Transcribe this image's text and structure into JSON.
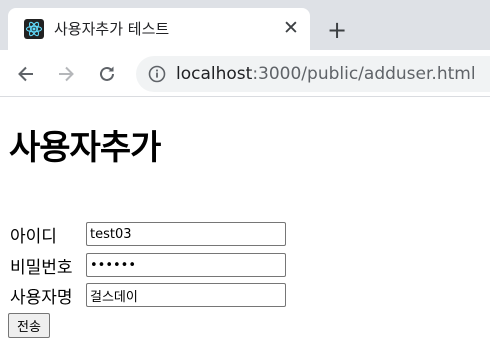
{
  "browser": {
    "tab_title": "사용자추가 테스트",
    "close_glyph": "✕",
    "new_tab_glyph": "+",
    "url_host": "localhost",
    "url_rest": ":3000/public/adduser.html"
  },
  "page": {
    "heading": "사용자추가",
    "form": {
      "fields": [
        {
          "label": "아이디",
          "value": "test03",
          "type": "text"
        },
        {
          "label": "비밀번호",
          "value": "test03",
          "type": "password"
        },
        {
          "label": "사용자명",
          "value": "걸스데이",
          "type": "text"
        }
      ],
      "submit_label": "전송"
    }
  },
  "icons": {
    "favicon": "react-logo-icon",
    "back": "arrow-left-icon",
    "forward": "arrow-right-icon",
    "reload": "reload-icon",
    "site_info": "info-icon"
  },
  "colors": {
    "tabbar_bg": "#dee1e6",
    "favicon_bg": "#222222",
    "favicon_accent": "#61dafb"
  }
}
